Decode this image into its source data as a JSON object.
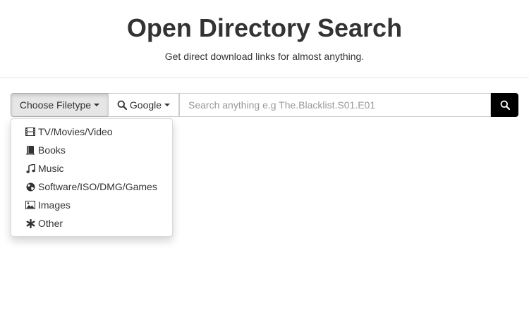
{
  "header": {
    "title": "Open Directory Search",
    "subtitle": "Get direct download links for almost anything."
  },
  "search": {
    "filetype_label": "Choose Filetype",
    "engine_label": "Google",
    "placeholder": "Search anything e.g The.Blacklist.S01.E01",
    "value": ""
  },
  "dropdown": {
    "items": [
      {
        "label": "TV/Movies/Video",
        "icon": "film-icon"
      },
      {
        "label": "Books",
        "icon": "book-icon"
      },
      {
        "label": "Music",
        "icon": "music-icon"
      },
      {
        "label": "Software/ISO/DMG/Games",
        "icon": "globe-icon"
      },
      {
        "label": "Images",
        "icon": "picture-icon"
      },
      {
        "label": "Other",
        "icon": "asterisk-icon"
      }
    ]
  },
  "colors": {
    "submit_bg": "#000000",
    "active_btn_bg": "#e6e6e6",
    "border": "#cccccc"
  }
}
